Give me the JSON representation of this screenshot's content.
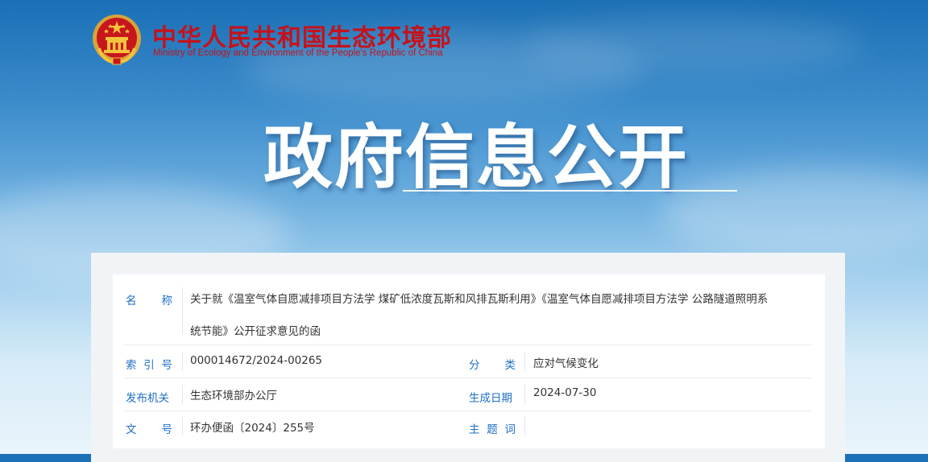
{
  "header": {
    "site_name_cn": "中华人民共和国生态环境部",
    "site_name_en": "Ministry of Ecology and Environment of the People's Republic of China",
    "emblem_icon": "national-emblem-icon"
  },
  "banner": {
    "title": "政府信息公开"
  },
  "colors": {
    "brand_red": "#c6121b",
    "label_blue": "#1f6fc5",
    "text": "#333333"
  },
  "info": {
    "name_label": [
      "名",
      "称"
    ],
    "name_value_line1": "关于就《温室气体自愿减排项目方法学 煤矿低浓度瓦斯和风排瓦斯利用》《温室气体自愿减排项目方法学 公路隧道照明系",
    "name_value_line2": "统节能》公开征求意见的函",
    "index_label": [
      "索",
      "引",
      "号"
    ],
    "index_value": "000014672/2024-00265",
    "category_label": [
      "分",
      "类"
    ],
    "category_value": "应对气候变化",
    "issuer_label": "发布机关",
    "issuer_value": "生态环境部办公厅",
    "date_label": "生成日期",
    "date_value": "2024-07-30",
    "docno_label": [
      "文",
      "号"
    ],
    "docno_value": "环办便函〔2024〕255号",
    "subject_label": [
      "主",
      "题",
      "词"
    ],
    "subject_value": ""
  }
}
